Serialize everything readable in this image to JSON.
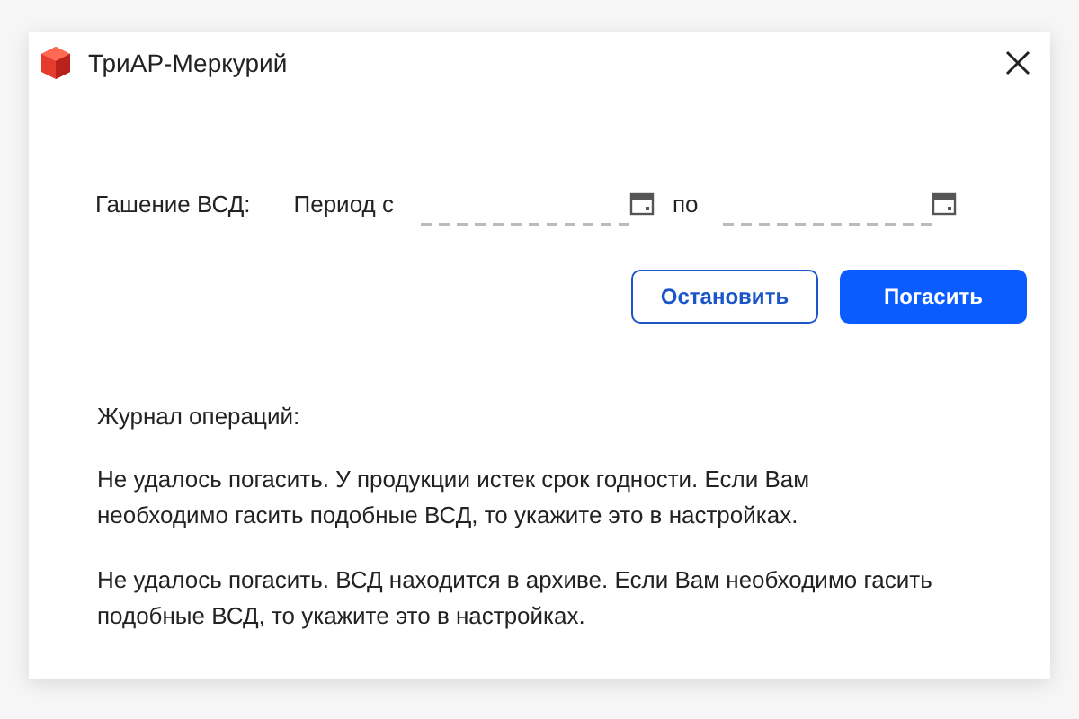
{
  "window": {
    "title": "ТриАР-Меркурий"
  },
  "filter": {
    "label": "Гашение ВСД:",
    "from_label": "Период с",
    "to_label": "по"
  },
  "buttons": [
    {
      "label": "Остановить",
      "kind": "outline"
    },
    {
      "label": "Погасить",
      "kind": "primary"
    }
  ],
  "log": {
    "title": "Журнал операций:",
    "messages": [
      "Не удалось погасить. У продукции истек срок годности. Если Вам необходимо гасить подобные ВСД, то укажите это в настройках.",
      "Не удалось погасить. ВСД находится в архиве. Если Вам необходимо гасить подобные ВСД, то укажите это в настройках."
    ]
  }
}
